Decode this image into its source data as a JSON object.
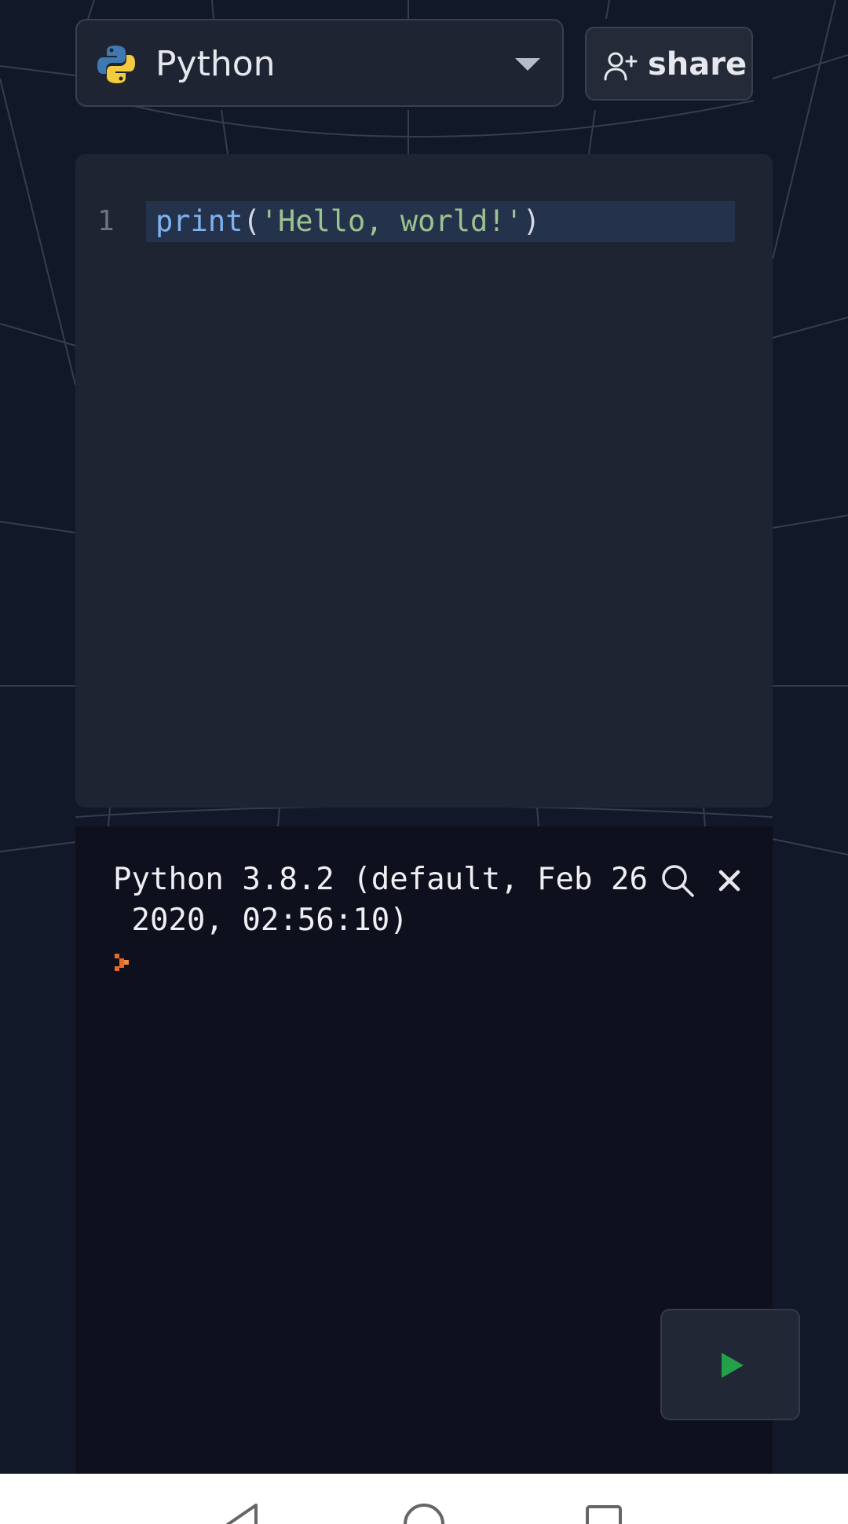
{
  "header": {
    "language": "Python",
    "share_label": "share"
  },
  "editor": {
    "lines": [
      {
        "number": "1",
        "tokens": {
          "fn": "print",
          "open": "(",
          "str": "'Hello, world!'",
          "close": ")"
        }
      }
    ]
  },
  "console": {
    "banner_line1": "Python 3.8.2 (default, Feb 26",
    "banner_line2": " 2020, 02:56:10)"
  },
  "icons": {
    "language": "python-logo-icon",
    "share": "person-plus-icon",
    "dropdown": "chevron-down-icon",
    "console_search": "search-icon",
    "console_close": "close-icon",
    "prompt": "prompt-arrow-icon",
    "run": "play-icon",
    "nav_back": "back-icon",
    "nav_home": "home-icon",
    "nav_recent": "recent-apps-icon"
  },
  "colors": {
    "background": "#111827",
    "editor_bg": "#1f2433",
    "console_bg": "#0e111d",
    "run_accent": "#22a04a",
    "prompt_accent": "#e8682a",
    "string": "#9dc290",
    "function": "#7fb2ef"
  }
}
